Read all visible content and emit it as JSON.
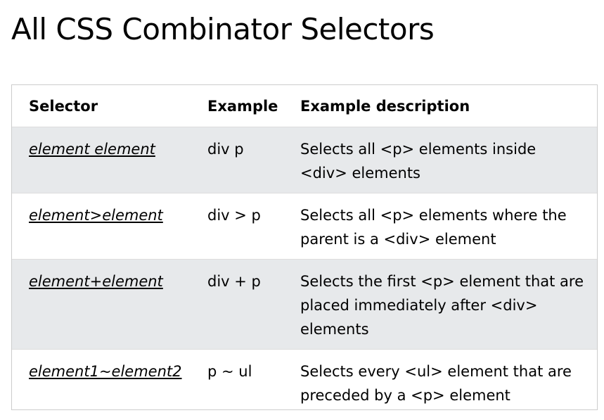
{
  "page": {
    "title": "All CSS Combinator Selectors"
  },
  "table": {
    "headers": {
      "selector": "Selector",
      "example": "Example",
      "description": "Example description"
    },
    "rows": [
      {
        "selector": "element element",
        "example": "div p",
        "description": "Selects all <p> elements inside <div> elements"
      },
      {
        "selector": "element>element",
        "example": "div > p",
        "description": "Selects all <p> elements where the parent is a <div> element"
      },
      {
        "selector": "element+element",
        "example": "div + p",
        "description": "Selects the first <p> element that are placed immediately after <div> elements"
      },
      {
        "selector": "element1~element2",
        "example": "p ~ ul",
        "description": "Selects every <ul> element that are preceded by a <p> element"
      }
    ]
  },
  "colors": {
    "stripe": "#e7e9eb",
    "border": "#cccccc",
    "text": "#000000"
  }
}
